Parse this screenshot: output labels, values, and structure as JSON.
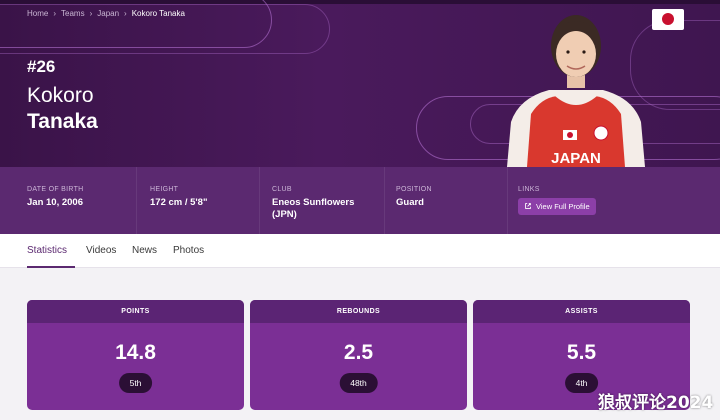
{
  "breadcrumb": [
    "Home",
    "Teams",
    "Japan",
    "Kokoro Tanaka"
  ],
  "player": {
    "number": "#26",
    "first_name": "Kokoro",
    "last_name": "Tanaka",
    "jersey_text": "JAPAN"
  },
  "info": {
    "dob_label": "DATE OF BIRTH",
    "dob": "Jan 10, 2006",
    "height_label": "HEIGHT",
    "height": "172 cm / 5'8\"",
    "club_label": "CLUB",
    "club": "Eneos Sunflowers (JPN)",
    "position_label": "POSITION",
    "position": "Guard",
    "links_label": "LINKS",
    "link_button": "View Full Profile"
  },
  "tabs": [
    "Statistics",
    "Videos",
    "News",
    "Photos"
  ],
  "stats": [
    {
      "label": "POINTS",
      "value": "14.8",
      "rank": "5th"
    },
    {
      "label": "REBOUNDS",
      "value": "2.5",
      "rank": "48th"
    },
    {
      "label": "ASSISTS",
      "value": "5.5",
      "rank": "4th"
    }
  ],
  "watermark": "狼叔评论2024",
  "colors": {
    "hero": "#4a1a5c",
    "info_bar": "#5b2970",
    "card": "#7b2f95",
    "flag_red": "#c8102e"
  }
}
